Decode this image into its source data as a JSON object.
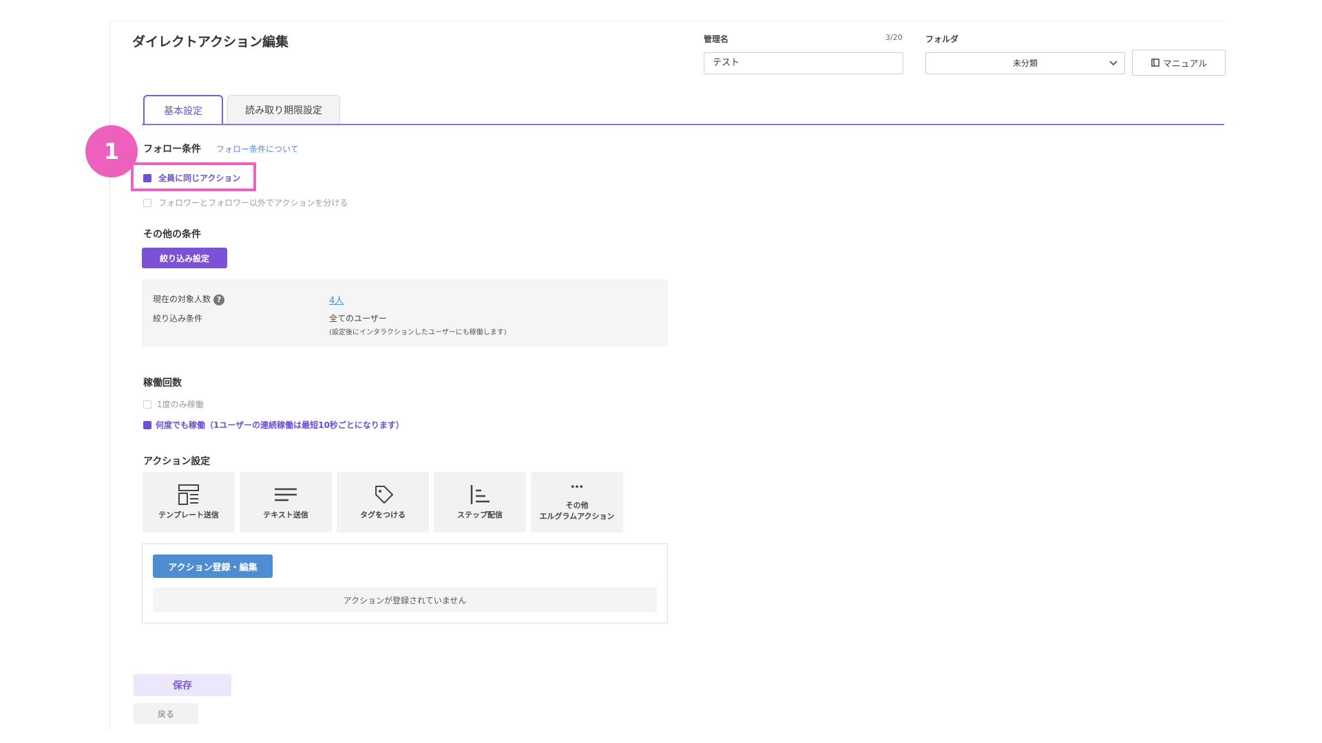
{
  "header": {
    "title": "ダイレクトアクション編集",
    "name_label": "管理名",
    "name_counter": "3/20",
    "name_value": "テスト",
    "folder_label": "フォルダ",
    "folder_value": "未分類",
    "manual_label": "マニュアル"
  },
  "tabs": [
    {
      "label": "基本設定",
      "active": true
    },
    {
      "label": "読み取り期限設定",
      "active": false
    }
  ],
  "annotation": {
    "step": "1",
    "color": "#ee60be"
  },
  "follow": {
    "title": "フォロー条件",
    "help_link": "フォロー条件について",
    "options": [
      {
        "label": "全員に同じアクション",
        "checked": true
      },
      {
        "label": "フォロワーとフォロワー以外でアクションを分ける",
        "checked": false
      }
    ]
  },
  "other": {
    "title": "その他の条件",
    "filter_button": "絞り込み設定",
    "target_label": "現在の対象人数",
    "help_mark": "?",
    "target_value": "4人",
    "filter_label": "絞り込み条件",
    "filter_value": "全てのユーザー",
    "filter_note": "(設定後にインタラクションしたユーザーにも稼働します)"
  },
  "frequency": {
    "title": "稼働回数",
    "options": [
      {
        "label": "1度のみ稼働",
        "checked": false
      },
      {
        "label": "何度でも稼働（1ユーザーの連続稼働は最短10秒ごとになります）",
        "checked": true
      }
    ]
  },
  "actions": {
    "title": "アクション設定",
    "tiles": [
      {
        "icon": "template-icon",
        "label": "テンプレート送信"
      },
      {
        "icon": "text-icon",
        "label": "テキスト送信"
      },
      {
        "icon": "tag-icon",
        "label": "タグをつける"
      },
      {
        "icon": "step-icon",
        "label": "ステップ配信"
      },
      {
        "icon": "more-icon",
        "label_line1": "その他",
        "label_line2": "エルグラムアクション"
      }
    ],
    "register_button": "アクション登録・編集",
    "empty_message": "アクションが登録されていません"
  },
  "footer": {
    "save_label": "保存",
    "back_label": "戻る"
  },
  "colors": {
    "accent": "#7b52d6",
    "link": "#4f8ad8",
    "highlight": "#ee60be"
  }
}
